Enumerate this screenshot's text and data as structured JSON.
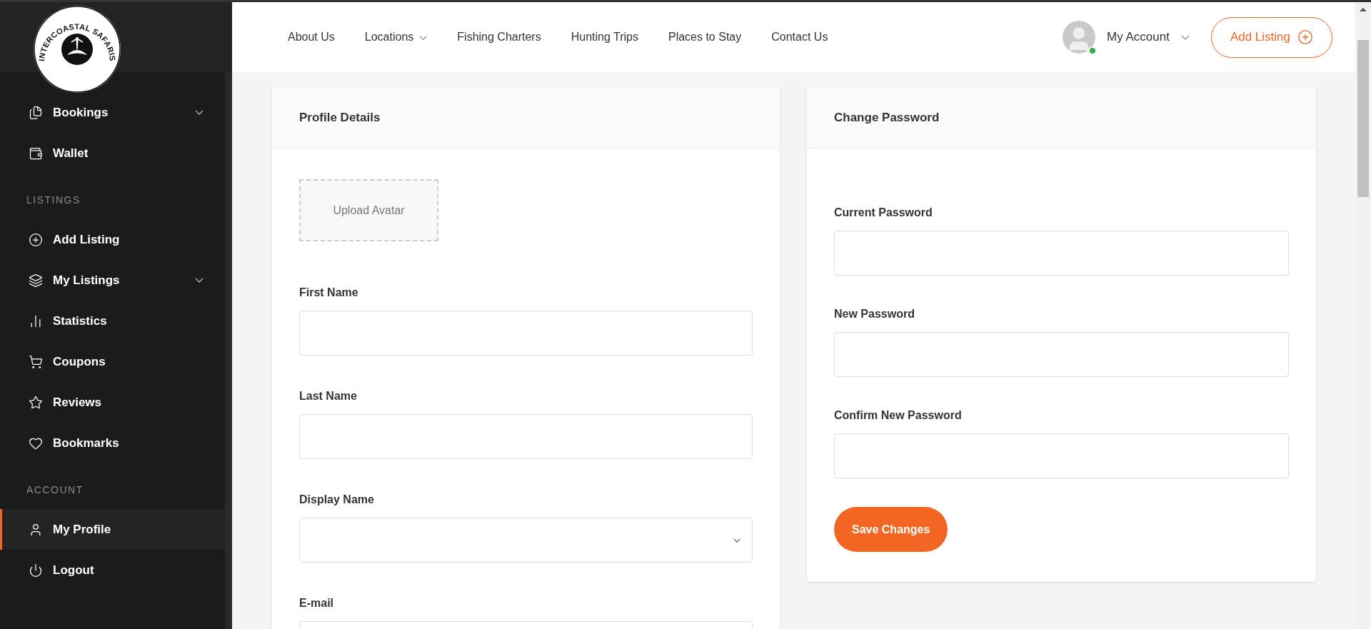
{
  "logo": {
    "text": "INTERCOASTAL SAFARIS"
  },
  "sidebar": {
    "sections": [
      {
        "items": [
          {
            "label": "Bookings",
            "submenu": true,
            "selected": false
          },
          {
            "label": "Wallet",
            "submenu": false,
            "selected": false
          }
        ]
      },
      {
        "heading": "LISTINGS",
        "items": [
          {
            "label": "Add Listing",
            "submenu": false,
            "selected": false
          },
          {
            "label": "My Listings",
            "submenu": true,
            "selected": false
          },
          {
            "label": "Statistics",
            "submenu": false,
            "selected": false
          },
          {
            "label": "Coupons",
            "submenu": false,
            "selected": false
          },
          {
            "label": "Reviews",
            "submenu": false,
            "selected": false
          },
          {
            "label": "Bookmarks",
            "submenu": false,
            "selected": false
          }
        ]
      },
      {
        "heading": "ACCOUNT",
        "items": [
          {
            "label": "My Profile",
            "submenu": false,
            "selected": true
          },
          {
            "label": "Logout",
            "submenu": false,
            "selected": false
          }
        ]
      }
    ]
  },
  "header": {
    "nav": [
      {
        "label": "About Us",
        "dropdown": false
      },
      {
        "label": "Locations",
        "dropdown": true
      },
      {
        "label": "Fishing Charters",
        "dropdown": false
      },
      {
        "label": "Hunting Trips",
        "dropdown": false
      },
      {
        "label": "Places to Stay",
        "dropdown": false
      },
      {
        "label": "Contact Us",
        "dropdown": false
      }
    ],
    "account": {
      "label": "My Account",
      "online": true
    },
    "add_listing_button": "Add Listing"
  },
  "profile_card": {
    "title": "Profile Details",
    "avatar_button": "Upload Avatar",
    "fields": [
      {
        "label": "First Name",
        "kind": "text"
      },
      {
        "label": "Last Name",
        "kind": "text"
      },
      {
        "label": "Display Name",
        "kind": "select"
      },
      {
        "label": "E-mail",
        "kind": "text"
      }
    ]
  },
  "password_card": {
    "title": "Change Password",
    "fields": [
      {
        "label": "Current Password"
      },
      {
        "label": "New Password"
      },
      {
        "label": "Confirm New Password"
      }
    ],
    "save_button": "Save Changes"
  }
}
